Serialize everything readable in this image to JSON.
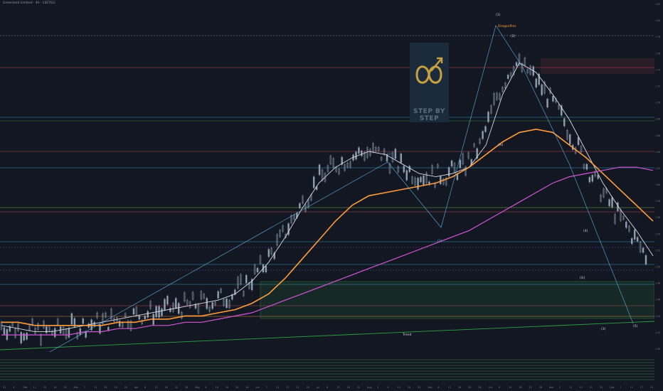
{
  "header": {
    "title": "Greenland Limited · 4h · LSETGG"
  },
  "logo": {
    "text": "STEP BY STEP"
  },
  "colors": {
    "bg": "#131722",
    "candle": "#8fa0b3",
    "ema_fast": "#d9d9e0",
    "ema_mid": "#ff9c3c",
    "ema_slow": "#d254d6",
    "ema_long": "#8a3fd0",
    "trend": "#2ea043"
  },
  "chart_data": {
    "type": "candlestick",
    "x_ticks": [
      "31",
      "4",
      "Feb",
      "11",
      "15",
      "19",
      "25",
      "Mar",
      "7",
      "11",
      "15",
      "19",
      "25",
      "Apr",
      "8",
      "12",
      "16",
      "22",
      "26",
      "May",
      "6",
      "10",
      "16",
      "20",
      "24",
      "Jun",
      "7",
      "11",
      "17",
      "21",
      "25",
      "Jul",
      "8",
      "12",
      "18",
      "22",
      "Aug",
      "5",
      "9",
      "15",
      "19",
      "23",
      "Sep",
      "6",
      "12",
      "16",
      "20",
      "26",
      "Oct",
      "8",
      "14",
      "18",
      "22",
      "28",
      "Nov",
      "5",
      "11",
      "15",
      "21",
      "25",
      "Dec",
      "7",
      "11",
      "17",
      "21"
    ],
    "y_ticks": [
      "1.82",
      "1.80",
      "1.78",
      "1.76",
      "1.74",
      "1.72",
      "1.70",
      "1.68",
      "1.66",
      "1.64",
      "1.62",
      "1.60",
      "1.58",
      "1.56",
      "1.54",
      "1.52",
      "1.50",
      "1.48",
      "1.46",
      "1.44",
      "1.42",
      "1.40"
    ],
    "annotations": [
      {
        "text": "Dragonflies"
      },
      {
        "text": "(1)"
      },
      {
        "text": "(2)"
      },
      {
        "text": "(4)"
      },
      {
        "text": "(3)"
      },
      {
        "text": "(5)"
      },
      {
        "text": "Trend"
      },
      {
        "text": "(i)"
      },
      {
        "text": "(ii)"
      },
      {
        "text": "(iv)"
      },
      {
        "text": "(iii)"
      }
    ],
    "ema_fast": [
      0.05,
      0.04,
      0.03,
      0.03,
      0.04,
      0.05,
      0.06,
      0.07,
      0.08,
      0.09,
      0.1,
      0.11,
      0.12,
      0.13,
      0.15,
      0.19,
      0.25,
      0.33,
      0.42,
      0.5,
      0.55,
      0.58,
      0.6,
      0.59,
      0.56,
      0.53,
      0.52,
      0.53,
      0.55,
      0.62,
      0.78,
      0.88,
      0.85,
      0.78,
      0.7,
      0.6,
      0.5,
      0.42,
      0.35,
      0.27
    ],
    "ema_mid": [
      0.06,
      0.06,
      0.05,
      0.05,
      0.05,
      0.05,
      0.05,
      0.06,
      0.06,
      0.07,
      0.07,
      0.08,
      0.08,
      0.09,
      0.1,
      0.12,
      0.15,
      0.2,
      0.26,
      0.32,
      0.38,
      0.43,
      0.46,
      0.47,
      0.48,
      0.49,
      0.5,
      0.52,
      0.55,
      0.59,
      0.63,
      0.66,
      0.67,
      0.66,
      0.62,
      0.58,
      0.53,
      0.48,
      0.43,
      0.38
    ],
    "ema_slow": [
      0.02,
      0.02,
      0.02,
      0.02,
      0.02,
      0.03,
      0.03,
      0.04,
      0.04,
      0.05,
      0.05,
      0.06,
      0.06,
      0.07,
      0.08,
      0.09,
      0.11,
      0.13,
      0.15,
      0.17,
      0.19,
      0.21,
      0.23,
      0.25,
      0.27,
      0.29,
      0.31,
      0.33,
      0.35,
      0.38,
      0.41,
      0.44,
      0.47,
      0.5,
      0.52,
      0.53,
      0.54,
      0.55,
      0.55,
      0.54
    ]
  }
}
